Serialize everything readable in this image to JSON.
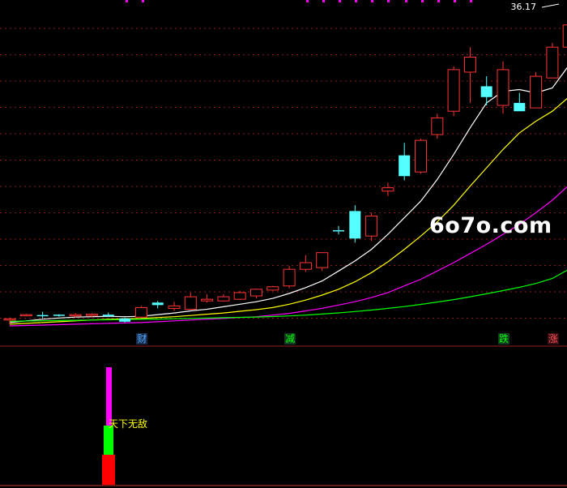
{
  "chart_data": [
    {
      "type": "candlestick",
      "price_label": "36.17",
      "ylim": [
        0,
        38
      ],
      "candles": [
        {
          "o": 0.7,
          "h": 1.0,
          "l": 0.2,
          "c": 0.85,
          "up": true
        },
        {
          "o": 1.35,
          "h": 1.45,
          "l": 1.2,
          "c": 1.3,
          "up": true
        },
        {
          "o": 1.25,
          "h": 1.7,
          "l": 0.9,
          "c": 1.3,
          "up": false
        },
        {
          "o": 1.35,
          "h": 1.4,
          "l": 1.1,
          "c": 1.25,
          "up": false
        },
        {
          "o": 1.3,
          "h": 1.55,
          "l": 1.0,
          "c": 1.35,
          "up": true
        },
        {
          "o": 1.3,
          "h": 1.5,
          "l": 1.0,
          "c": 1.4,
          "up": true
        },
        {
          "o": 1.35,
          "h": 1.6,
          "l": 1.15,
          "c": 1.15,
          "up": false
        },
        {
          "o": 0.9,
          "h": 1.0,
          "l": 0.4,
          "c": 0.5,
          "up": false
        },
        {
          "o": 1.05,
          "h": 2.4,
          "l": 0.95,
          "c": 2.2,
          "up": true
        },
        {
          "o": 2.5,
          "h": 3.0,
          "l": 2.1,
          "c": 2.8,
          "up": false
        },
        {
          "o": 2.1,
          "h": 2.9,
          "l": 1.8,
          "c": 2.4,
          "up": true
        },
        {
          "o": 2.0,
          "h": 4.0,
          "l": 1.9,
          "c": 3.5,
          "up": true
        },
        {
          "o": 3.0,
          "h": 3.8,
          "l": 2.8,
          "c": 3.2,
          "up": true
        },
        {
          "o": 3.0,
          "h": 3.8,
          "l": 2.9,
          "c": 3.5,
          "up": true
        },
        {
          "o": 3.2,
          "h": 4.2,
          "l": 3.1,
          "c": 4.0,
          "up": true
        },
        {
          "o": 3.6,
          "h": 4.5,
          "l": 3.3,
          "c": 4.4,
          "up": true
        },
        {
          "o": 4.3,
          "h": 4.8,
          "l": 4.2,
          "c": 4.7,
          "up": true
        },
        {
          "o": 4.8,
          "h": 7.2,
          "l": 4.5,
          "c": 6.8,
          "up": true
        },
        {
          "o": 6.8,
          "h": 8.5,
          "l": 6.5,
          "c": 7.6,
          "up": true
        },
        {
          "o": 7.0,
          "h": 8.8,
          "l": 6.6,
          "c": 8.8,
          "up": true
        },
        {
          "o": 11.5,
          "h": 12.0,
          "l": 11.0,
          "c": 11.5,
          "up": false
        },
        {
          "o": 13.8,
          "h": 14.5,
          "l": 10.0,
          "c": 10.5,
          "up": false
        },
        {
          "o": 10.8,
          "h": 13.6,
          "l": 10.2,
          "c": 13.2,
          "up": true
        },
        {
          "o": 16.2,
          "h": 17.2,
          "l": 15.6,
          "c": 16.6,
          "up": true
        },
        {
          "o": 18.0,
          "h": 22.0,
          "l": 17.5,
          "c": 20.5,
          "up": false
        },
        {
          "o": 18.5,
          "h": 22.5,
          "l": 18.3,
          "c": 22.3,
          "up": true
        },
        {
          "o": 23.0,
          "h": 25.5,
          "l": 22.5,
          "c": 25.0,
          "up": true
        },
        {
          "o": 25.8,
          "h": 31.2,
          "l": 25.2,
          "c": 30.8,
          "up": true
        },
        {
          "o": 30.5,
          "h": 33.5,
          "l": 26.8,
          "c": 32.3,
          "up": true
        },
        {
          "o": 28.8,
          "h": 30.0,
          "l": 26.5,
          "c": 27.5,
          "up": false
        },
        {
          "o": 26.5,
          "h": 31.8,
          "l": 25.5,
          "c": 30.8,
          "up": true
        },
        {
          "o": 26.8,
          "h": 28.0,
          "l": 25.8,
          "c": 25.8,
          "up": false
        },
        {
          "o": 26.2,
          "h": 30.5,
          "l": 26.2,
          "c": 30.0,
          "up": true
        },
        {
          "o": 29.8,
          "h": 34.0,
          "l": 29.8,
          "c": 33.5,
          "up": true
        },
        {
          "o": 33.5,
          "h": 37.3,
          "l": 30.8,
          "c": 36.17,
          "up": true
        }
      ],
      "series": [
        {
          "color": "#ffffff",
          "values": [
            0.4,
            0.6,
            0.8,
            0.95,
            1.05,
            1.1,
            1.15,
            1.1,
            1.15,
            1.35,
            1.55,
            1.8,
            2.0,
            2.3,
            2.6,
            2.9,
            3.3,
            3.9,
            4.6,
            5.4,
            6.6,
            7.8,
            9.2,
            11.0,
            13.0,
            15.0,
            17.6,
            20.6,
            23.8,
            26.8,
            28.2,
            28.4,
            28.0,
            28.6,
            31.3
          ]
        },
        {
          "color": "#ffff00",
          "values": [
            0.2,
            0.3,
            0.4,
            0.5,
            0.6,
            0.7,
            0.8,
            0.85,
            0.9,
            1.0,
            1.1,
            1.25,
            1.4,
            1.55,
            1.75,
            1.95,
            2.2,
            2.6,
            3.1,
            3.7,
            4.4,
            5.3,
            6.4,
            7.7,
            9.2,
            10.8,
            12.5,
            14.5,
            16.8,
            19.0,
            21.2,
            23.2,
            24.6,
            25.8,
            27.5
          ]
        },
        {
          "color": "#ff00ff",
          "values": [
            0.0,
            0.05,
            0.1,
            0.15,
            0.2,
            0.25,
            0.3,
            0.35,
            0.4,
            0.5,
            0.6,
            0.7,
            0.8,
            0.9,
            1.0,
            1.1,
            1.3,
            1.5,
            1.8,
            2.1,
            2.5,
            2.9,
            3.4,
            4.0,
            4.8,
            5.6,
            6.6,
            7.6,
            8.7,
            9.8,
            11.0,
            12.2,
            13.6,
            15.1,
            16.9
          ]
        },
        {
          "color": "#00ff00",
          "values": [
            0.55,
            0.58,
            0.61,
            0.64,
            0.67,
            0.7,
            0.73,
            0.76,
            0.79,
            0.82,
            0.86,
            0.9,
            0.94,
            0.98,
            1.02,
            1.06,
            1.12,
            1.2,
            1.3,
            1.42,
            1.56,
            1.72,
            1.9,
            2.1,
            2.32,
            2.58,
            2.86,
            3.16,
            3.5,
            3.86,
            4.24,
            4.64,
            5.1,
            5.7,
            6.8
          ]
        }
      ],
      "markers": [
        {
          "text": "财",
          "candle": 8,
          "color": "#4fa9ff",
          "bg": "#1b2b4a"
        },
        {
          "text": "减",
          "candle": 17,
          "color": "#00ff00",
          "bg": "#0f3a1e"
        },
        {
          "text": "跌",
          "candle": 30,
          "color": "#00ff00",
          "bg": "#0f3a1e"
        },
        {
          "text": "涨",
          "candle": 33,
          "color": "#ff5050",
          "bg": "#3a0f14"
        }
      ]
    },
    {
      "type": "bar",
      "label": "天下无敌",
      "segments": [
        {
          "color": "#ff0000",
          "value": 37
        },
        {
          "color": "#00ff00",
          "value": 36
        },
        {
          "color": "#ff00ff",
          "value": 72
        }
      ]
    }
  ],
  "watermark": "6o7o.com"
}
